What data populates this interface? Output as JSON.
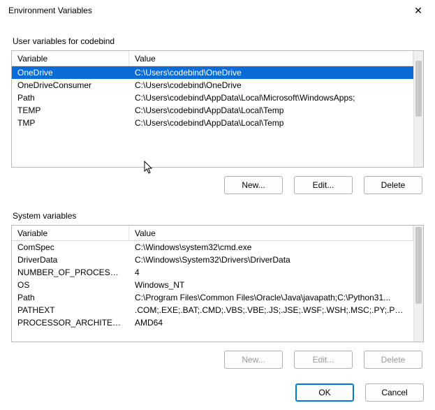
{
  "window": {
    "title": "Environment Variables"
  },
  "userSection": {
    "label": "User variables for codebind",
    "headers": {
      "variable": "Variable",
      "value": "Value"
    },
    "rows": [
      {
        "variable": "OneDrive",
        "value": "C:\\Users\\codebind\\OneDrive",
        "selected": true
      },
      {
        "variable": "OneDriveConsumer",
        "value": "C:\\Users\\codebind\\OneDrive",
        "selected": false
      },
      {
        "variable": "Path",
        "value": "C:\\Users\\codebind\\AppData\\Local\\Microsoft\\WindowsApps;",
        "selected": false
      },
      {
        "variable": "TEMP",
        "value": "C:\\Users\\codebind\\AppData\\Local\\Temp",
        "selected": false
      },
      {
        "variable": "TMP",
        "value": "C:\\Users\\codebind\\AppData\\Local\\Temp",
        "selected": false
      }
    ],
    "buttons": {
      "new": "New...",
      "edit": "Edit...",
      "delete": "Delete"
    }
  },
  "systemSection": {
    "label": "System variables",
    "headers": {
      "variable": "Variable",
      "value": "Value"
    },
    "rows": [
      {
        "variable": "ComSpec",
        "value": "C:\\Windows\\system32\\cmd.exe",
        "selected": false
      },
      {
        "variable": "DriverData",
        "value": "C:\\Windows\\System32\\Drivers\\DriverData",
        "selected": false
      },
      {
        "variable": "NUMBER_OF_PROCESSORS",
        "value": "4",
        "selected": false
      },
      {
        "variable": "OS",
        "value": "Windows_NT",
        "selected": false
      },
      {
        "variable": "Path",
        "value": "C:\\Program Files\\Common Files\\Oracle\\Java\\javapath;C:\\Python31...",
        "selected": false
      },
      {
        "variable": "PATHEXT",
        "value": ".COM;.EXE;.BAT;.CMD;.VBS;.VBE;.JS;.JSE;.WSF;.WSH;.MSC;.PY;.PYW",
        "selected": false
      },
      {
        "variable": "PROCESSOR_ARCHITECTURE",
        "value": "AMD64",
        "selected": false
      }
    ],
    "buttons": {
      "new": "New...",
      "edit": "Edit...",
      "delete": "Delete"
    }
  },
  "dialogButtons": {
    "ok": "OK",
    "cancel": "Cancel"
  }
}
